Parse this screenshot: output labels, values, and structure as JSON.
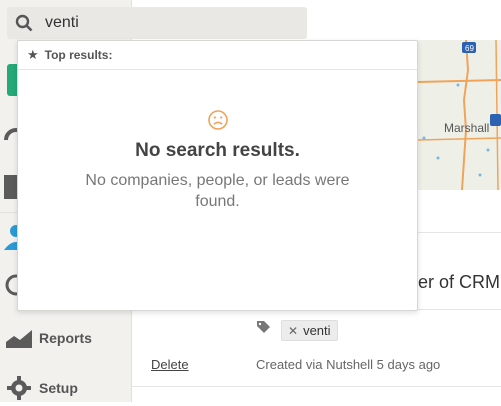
{
  "search": {
    "query": "venti"
  },
  "dropdown": {
    "header": "Top results:",
    "title": "No search results.",
    "message": "No companies, people, or leads were found."
  },
  "sidebar": {
    "items": [
      {
        "label": "Reports",
        "icon": "reports-icon"
      },
      {
        "label": "Setup",
        "icon": "gear-icon"
      }
    ]
  },
  "map": {
    "place": "Marshall",
    "shields": [
      "69"
    ]
  },
  "content": {
    "title_fragment": "er of CRM",
    "tag": "venti",
    "delete_label": "Delete",
    "created_text": "Created via Nutshell 5 days ago"
  },
  "colors": {
    "accent_green": "#25a979",
    "map_road": "#f0a35a",
    "frown": "#f0a35a"
  }
}
